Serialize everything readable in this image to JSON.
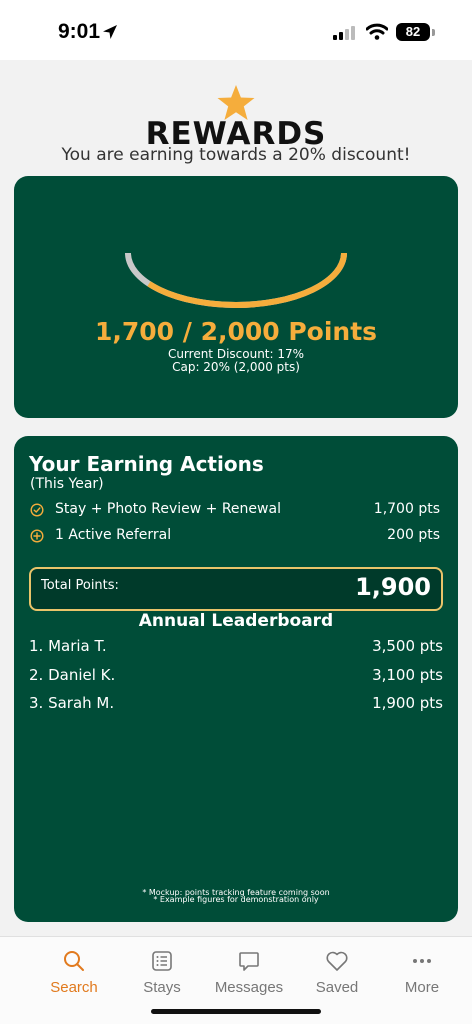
{
  "status_bar": {
    "time": "9:01",
    "battery": "82"
  },
  "header": {
    "title": "REWARDS",
    "subtitle": "You are earning towards a 20% discount!"
  },
  "progress_card": {
    "points_text": "1,700 / 2,000 Points",
    "current_discount": "Current Discount: 17%",
    "cap": "Cap: 20% (2,000 pts)",
    "progress_fraction": 0.85,
    "accent_color": "#f5ad3c",
    "track_color": "#c8c8c8"
  },
  "actions_card": {
    "title": "Your Earning Actions",
    "subtitle": "(This Year)",
    "actions": [
      {
        "icon": "check-circle-icon",
        "label": "Stay + Photo Review + Renewal",
        "points": "1,700 pts"
      },
      {
        "icon": "plus-circle-icon",
        "label": "1 Active Referral",
        "points": "200 pts"
      }
    ],
    "total_label": "Total Points:",
    "total_value": "1,900",
    "leaderboard_title": "Annual Leaderboard",
    "leaderboard": [
      {
        "name": "1. Maria T.",
        "points": "3,500 pts"
      },
      {
        "name": "2. Daniel K.",
        "points": "3,100 pts"
      },
      {
        "name": "3. Sarah M.",
        "points": "1,900 pts"
      }
    ],
    "footnotes": [
      "* Mockup: points tracking feature coming soon",
      "* Example figures for demonstration only"
    ]
  },
  "tabbar": {
    "tabs": [
      {
        "label": "Search",
        "icon": "search-icon",
        "active": true
      },
      {
        "label": "Stays",
        "icon": "list-icon",
        "active": false
      },
      {
        "label": "Messages",
        "icon": "chat-bubble-icon",
        "active": false
      },
      {
        "label": "Saved",
        "icon": "heart-icon",
        "active": false
      },
      {
        "label": "More",
        "icon": "more-dots-icon",
        "active": false
      }
    ]
  },
  "colors": {
    "card_green": "#004d38",
    "accent_orange": "#e17a1e",
    "star_gold": "#f5ad3c",
    "total_border": "#e9c46a"
  }
}
